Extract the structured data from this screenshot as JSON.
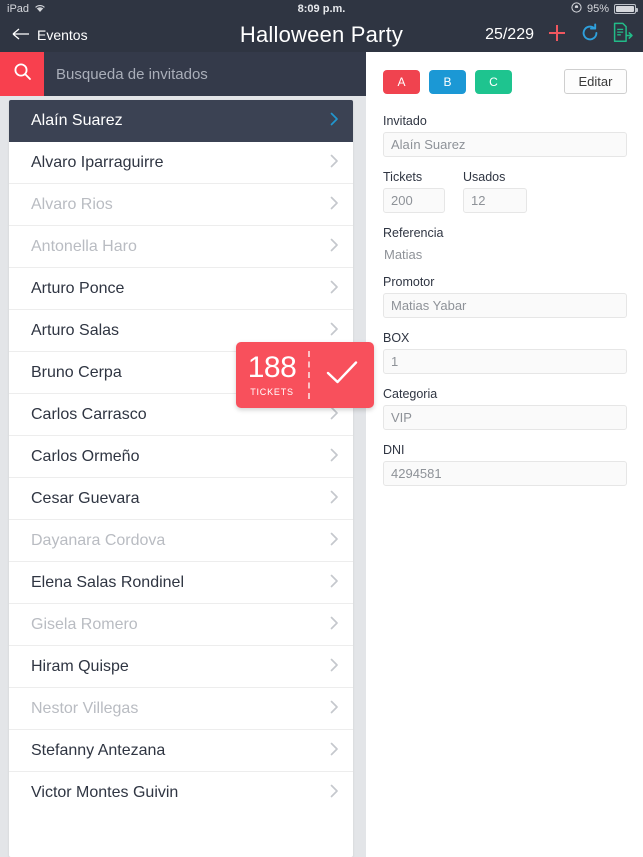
{
  "statusbar": {
    "device": "iPad",
    "wifi_icon": "wifi-icon",
    "time": "8:09 p.m.",
    "rotation_lock_icon": "rotation-lock-icon",
    "battery_percent": "95%",
    "battery_icon": "battery-icon"
  },
  "navbar": {
    "back_icon": "arrow-left-icon",
    "back_label": "Eventos",
    "title": "Halloween Party",
    "count": "25/229",
    "add_icon": "plus-icon",
    "refresh_icon": "refresh-icon",
    "export_icon": "document-export-icon",
    "add_color": "#f0575f",
    "refresh_color": "#2ea0dd",
    "export_color": "#22bb88"
  },
  "search": {
    "icon": "search-icon",
    "placeholder": "Busqueda de invitados",
    "value": "",
    "button_color": "#f8404e"
  },
  "guest_list": {
    "rows": [
      {
        "name": "Alaín Suarez",
        "selected": true,
        "dim": false
      },
      {
        "name": "Alvaro Iparraguirre",
        "selected": false,
        "dim": false
      },
      {
        "name": "Alvaro Rios",
        "selected": false,
        "dim": true
      },
      {
        "name": "Antonella Haro",
        "selected": false,
        "dim": true
      },
      {
        "name": "Arturo Ponce",
        "selected": false,
        "dim": false
      },
      {
        "name": "Arturo Salas",
        "selected": false,
        "dim": false
      },
      {
        "name": "Bruno Cerpa",
        "selected": false,
        "dim": false
      },
      {
        "name": "Carlos Carrasco",
        "selected": false,
        "dim": false
      },
      {
        "name": "Carlos Ormeño",
        "selected": false,
        "dim": false
      },
      {
        "name": "Cesar Guevara",
        "selected": false,
        "dim": false
      },
      {
        "name": "Dayanara Cordova",
        "selected": false,
        "dim": true
      },
      {
        "name": "Elena Salas Rondinel",
        "selected": false,
        "dim": false
      },
      {
        "name": "Gisela Romero",
        "selected": false,
        "dim": true
      },
      {
        "name": "Hiram Quispe",
        "selected": false,
        "dim": false
      },
      {
        "name": "Nestor Villegas",
        "selected": false,
        "dim": true
      },
      {
        "name": "Stefanny Antezana",
        "selected": false,
        "dim": false
      },
      {
        "name": "Victor Montes Guivin",
        "selected": false,
        "dim": false
      }
    ],
    "chevron_icon": "chevron-right-icon"
  },
  "ticket_badge": {
    "count": "188",
    "label": "TICKETS",
    "check_icon": "check-icon",
    "color": "#f8505c"
  },
  "detail": {
    "tags": [
      {
        "label": "A",
        "color": "#f0434f"
      },
      {
        "label": "B",
        "color": "#1b98d5"
      },
      {
        "label": "C",
        "color": "#1ec48f"
      }
    ],
    "edit_label": "Editar",
    "fields": [
      {
        "label": "Invitado",
        "value": "Alaín Suarez"
      },
      {
        "label": "Tickets",
        "value": "200"
      },
      {
        "label": "Usados",
        "value": "12"
      },
      {
        "label": "Referencia",
        "value": "Matias"
      },
      {
        "label": "Promotor",
        "value": "Matias Yabar"
      },
      {
        "label": "BOX",
        "value": "1"
      },
      {
        "label": "Categoria",
        "value": "VIP"
      },
      {
        "label": "DNI",
        "value": "4294581"
      }
    ]
  }
}
